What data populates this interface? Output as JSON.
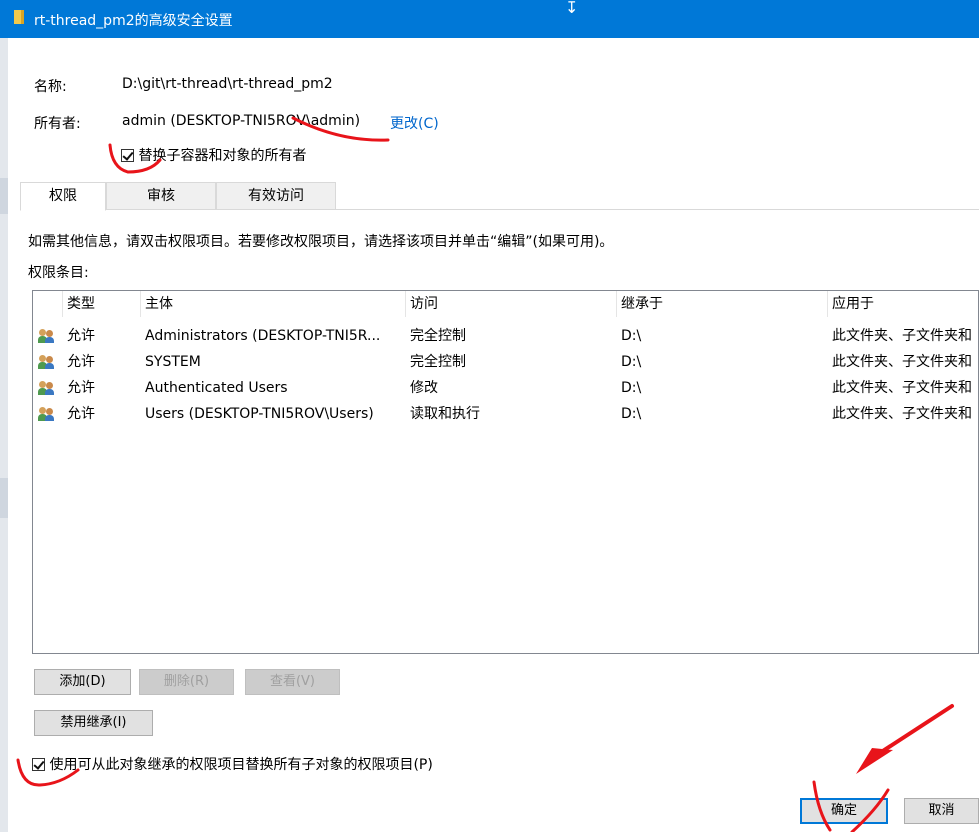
{
  "window": {
    "title": "rt-thread_pm2的高级安全设置"
  },
  "fields": {
    "name_label": "名称:",
    "name_value": "D:\\git\\rt-thread\\rt-thread_pm2",
    "owner_label": "所有者:",
    "owner_value": "admin (DESKTOP-TNI5ROV\\admin)",
    "change_link": "更改(C)",
    "replace_owner_label": "替换子容器和对象的所有者"
  },
  "tabs": [
    {
      "label": "权限",
      "active": true
    },
    {
      "label": "审核",
      "active": false
    },
    {
      "label": "有效访问",
      "active": false
    }
  ],
  "info_text": "如需其他信息，请双击权限项目。若要修改权限项目，请选择该项目并单击“编辑”(如果可用)。",
  "entries_label": "权限条目:",
  "table": {
    "columns": [
      "类型",
      "主体",
      "访问",
      "继承于",
      "应用于"
    ],
    "rows": [
      {
        "type": "允许",
        "principal": "Administrators (DESKTOP-TNI5R...",
        "access": "完全控制",
        "inherited": "D:\\",
        "applies": "此文件夹、子文件夹和"
      },
      {
        "type": "允许",
        "principal": "SYSTEM",
        "access": "完全控制",
        "inherited": "D:\\",
        "applies": "此文件夹、子文件夹和"
      },
      {
        "type": "允许",
        "principal": "Authenticated Users",
        "access": "修改",
        "inherited": "D:\\",
        "applies": "此文件夹、子文件夹和"
      },
      {
        "type": "允许",
        "principal": "Users (DESKTOP-TNI5ROV\\Users)",
        "access": "读取和执行",
        "inherited": "D:\\",
        "applies": "此文件夹、子文件夹和"
      }
    ]
  },
  "buttons": {
    "add": "添加(D)",
    "remove": "删除(R)",
    "view": "查看(V)",
    "disable_inheritance": "禁用继承(I)",
    "ok": "确定",
    "cancel": "取消"
  },
  "replace_child_label": "使用可从此对象继承的权限项目替换所有子对象的权限项目(P)",
  "colors": {
    "titlebar": "#0078d7",
    "link": "#0066cc",
    "annotation": "#e8141a"
  }
}
